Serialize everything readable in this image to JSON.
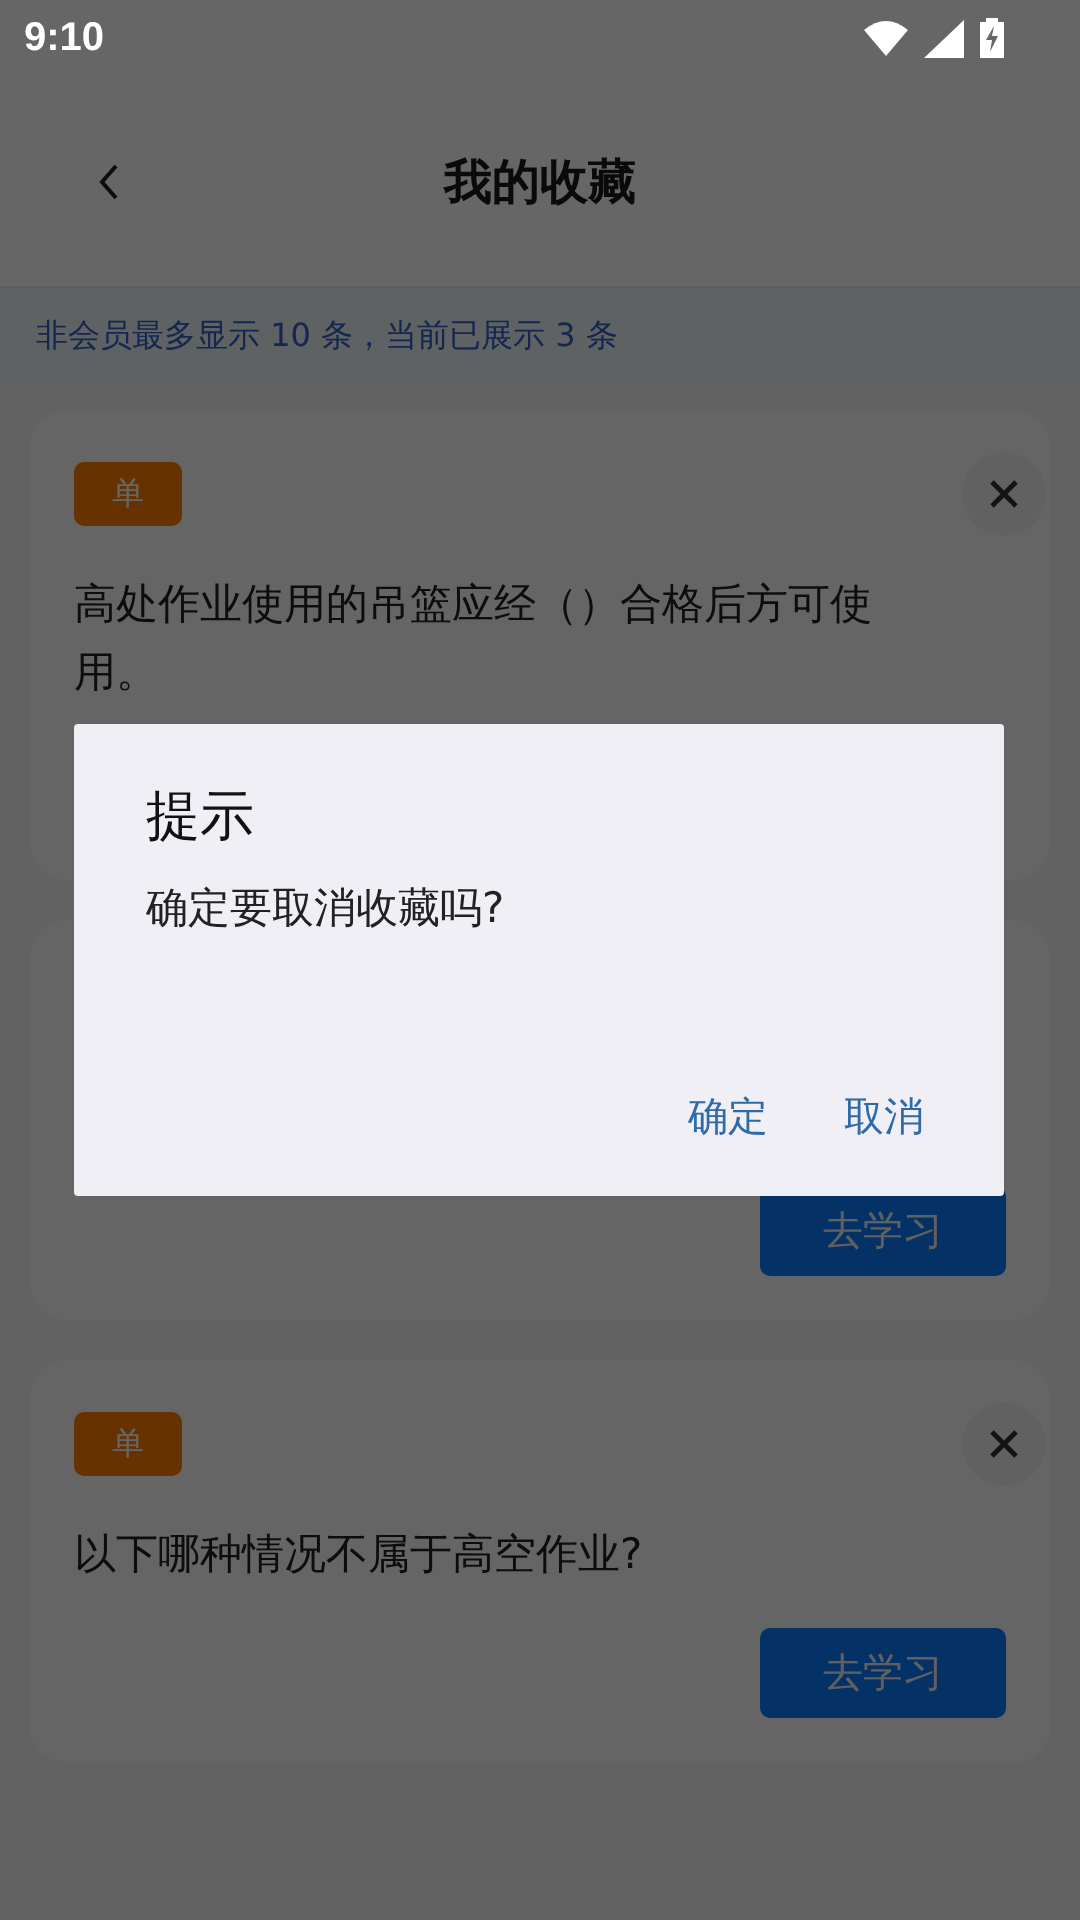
{
  "status_bar": {
    "time": "9:10"
  },
  "header": {
    "title": "我的收藏"
  },
  "notice": "非会员最多显示 10 条，当前已展示 3 条",
  "cards": [
    {
      "badge": "单",
      "question": "高处作业使用的吊篮应经（）合格后方可使用。"
    },
    {
      "button": "去学习"
    },
    {
      "badge": "单",
      "question": "以下哪种情况不属于高空作业?",
      "button": "去学习"
    }
  ],
  "dialog": {
    "title": "提示",
    "message": "确定要取消收藏吗?",
    "buttons": [
      "确定",
      "取消"
    ]
  }
}
